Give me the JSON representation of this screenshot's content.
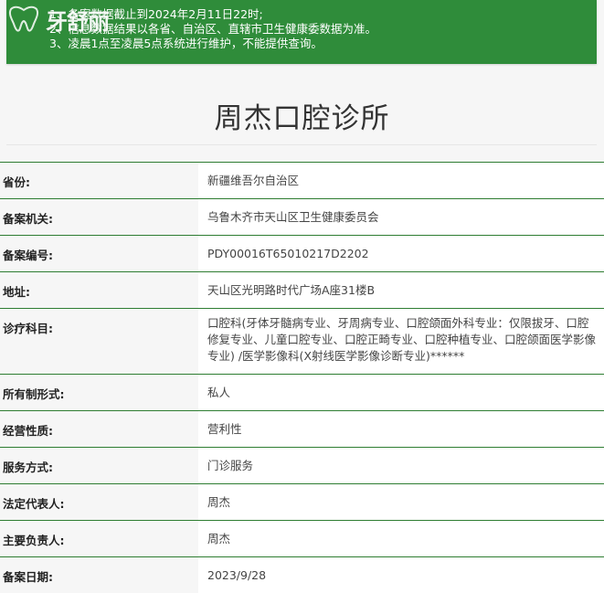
{
  "notice": {
    "lines": [
      "1、备案数据截止到2024年2月11日22时;",
      "2、信息数据结果以各省、自治区、直辖市卫生健康委数据为准。",
      "3、凌晨1点至凌晨5点系统进行维护，不能提供查询。"
    ],
    "logo_text": "牙舒丽"
  },
  "clinic": {
    "title": "周杰口腔诊所"
  },
  "details": [
    {
      "label": "省份:",
      "value": "新疆维吾尔自治区"
    },
    {
      "label": "备案机关:",
      "value": "乌鲁木齐市天山区卫生健康委员会"
    },
    {
      "label": "备案编号:",
      "value": "PDY00016T65010217D2202"
    },
    {
      "label": "地址:",
      "value": "天山区光明路时代广场A座31楼B"
    },
    {
      "label": "诊疗科目:",
      "value": "口腔科(牙体牙髓病专业、牙周病专业、口腔颌面外科专业：仅限拔牙、口腔修复专业、儿童口腔专业、口腔正畸专业、口腔种植专业、口腔颌面医学影像专业) /医学影像科(X射线医学影像诊断专业)******"
    },
    {
      "label": "所有制形式:",
      "value": "私人"
    },
    {
      "label": "经营性质:",
      "value": "营利性"
    },
    {
      "label": "服务方式:",
      "value": "门诊服务"
    },
    {
      "label": "法定代表人:",
      "value": "周杰"
    },
    {
      "label": "主要负责人:",
      "value": "周杰"
    },
    {
      "label": "备案日期:",
      "value": "2023/9/28"
    }
  ],
  "colors": {
    "banner": "#2f8c3a",
    "row_border": "#2e7d32"
  }
}
